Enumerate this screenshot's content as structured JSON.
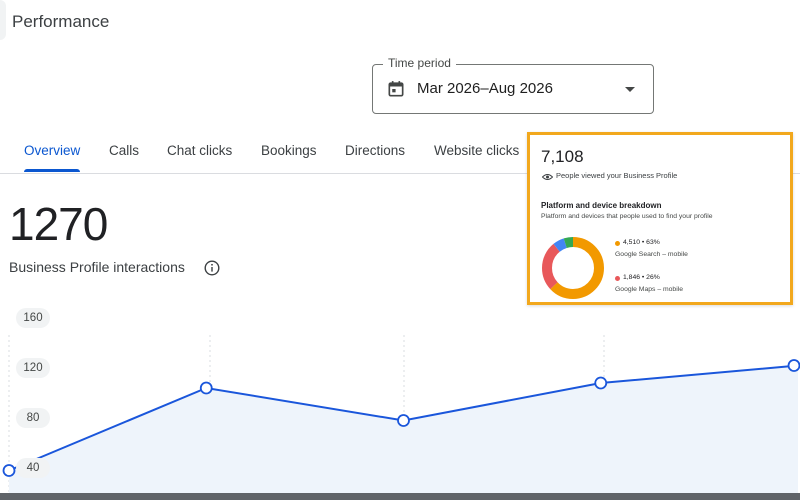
{
  "page": {
    "title": "Performance"
  },
  "time_period": {
    "label": "Time period",
    "value": "Mar 2026–Aug 2026",
    "icon": "calendar-icon"
  },
  "tabs": [
    {
      "label": "Overview",
      "active": true
    },
    {
      "label": "Calls"
    },
    {
      "label": "Chat clicks"
    },
    {
      "label": "Bookings"
    },
    {
      "label": "Directions"
    },
    {
      "label": "Website clicks"
    }
  ],
  "metric": {
    "value": "1270",
    "label": "Business Profile interactions",
    "icon": "info-icon"
  },
  "chart_data": {
    "type": "line",
    "yticks": [
      "160",
      "120",
      "80",
      "40"
    ],
    "ylim": [
      32,
      170
    ],
    "y": [
      38,
      104,
      78,
      108,
      122
    ],
    "x": [
      0,
      1,
      2,
      3,
      4
    ],
    "line_color": "#1a56db",
    "fill_color": "#eef4fb",
    "grid": "vertical dotted"
  },
  "card": {
    "total": "7,108",
    "subtitle": "People viewed your Business Profile",
    "heading": "Platform and device breakdown",
    "description": "Platform and devices that people used to find your profile",
    "border_color": "#f2a81d",
    "legend": [
      {
        "value": "4,510 • 63%",
        "name": "Google Search – mobile",
        "color": "#f29900"
      },
      {
        "value": "1,846 • 26%",
        "name": "Google Maps – mobile",
        "color": "#e8585a"
      }
    ],
    "donut_segments": [
      {
        "share": 0.63,
        "color": "#f29900"
      },
      {
        "share": 0.26,
        "color": "#e8585a"
      },
      {
        "share": 0.06,
        "color": "#4285f4"
      },
      {
        "share": 0.05,
        "color": "#34a853"
      }
    ]
  }
}
